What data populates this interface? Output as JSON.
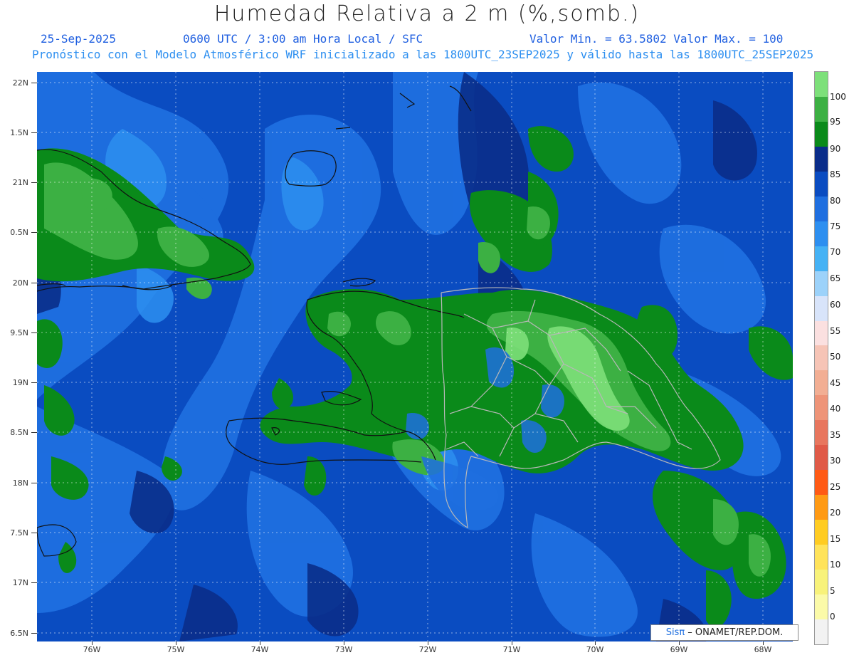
{
  "header": {
    "title": "Humedad Relativa a 2 m (%,somb.)",
    "date": "25-Sep-2025",
    "time": "0600 UTC / 3:00 am Hora Local / SFC",
    "min_max": "Valor Min. = 63.5802  Valor Max. = 100",
    "forecast": "Pronóstico con el Modelo Atmosférico WRF inicializado a las 1800UTC_23SEP2025 y válido hasta las  1800UTC_25SEP2025"
  },
  "axes": {
    "lat_labels": [
      "22N",
      "1.5N",
      "21N",
      "0.5N",
      "20N",
      "9.5N",
      "19N",
      "8.5N",
      "18N",
      "7.5N",
      "17N",
      "6.5N"
    ],
    "lon_labels": [
      "76W",
      "75W",
      "74W",
      "73W",
      "72W",
      "71W",
      "70W",
      "69W",
      "68W"
    ]
  },
  "legend": {
    "labels": [
      "100",
      "95",
      "90",
      "85",
      "80",
      "75",
      "70",
      "65",
      "60",
      "55",
      "50",
      "45",
      "40",
      "35",
      "30",
      "25",
      "20",
      "15",
      "10",
      "5",
      "0"
    ],
    "colors": [
      "#7de07a",
      "#3cb043",
      "#0a8a1a",
      "#0a2d8a",
      "#0a4cc1",
      "#1f6fe0",
      "#2d8ff0",
      "#45b2f5",
      "#9cd2fa",
      "#d8e4fa",
      "#fbe0e0",
      "#f6c4b6",
      "#f2ae93",
      "#ee9478",
      "#e8765e",
      "#e05a48",
      "#ff5a14",
      "#ff9a14",
      "#ffcc22",
      "#ffe35a",
      "#f8f27a",
      "#fbfaa8",
      "#f2f2f2"
    ]
  },
  "credit": {
    "sis": "Sisπ",
    "rest": " – ONAMET/REP.DOM."
  }
}
